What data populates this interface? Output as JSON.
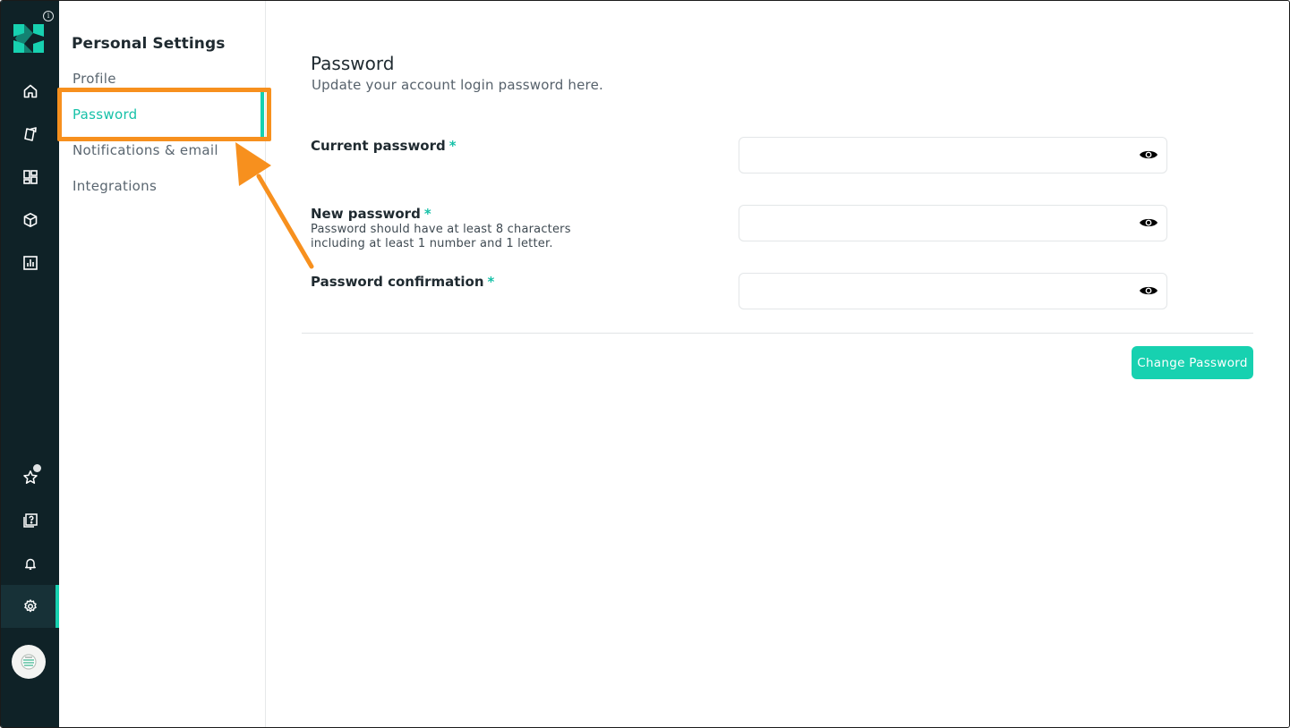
{
  "rail": {
    "items": [
      {
        "name": "home",
        "icon": "home-icon"
      },
      {
        "name": "campaigns",
        "icon": "tag-icon"
      },
      {
        "name": "dashboard",
        "icon": "dashboard-icon"
      },
      {
        "name": "products",
        "icon": "box-icon"
      },
      {
        "name": "reports",
        "icon": "bar-chart-icon"
      },
      {
        "name": "whats-new",
        "icon": "star-icon"
      },
      {
        "name": "help",
        "icon": "help-book-icon"
      },
      {
        "name": "notifications",
        "icon": "bell-icon"
      },
      {
        "name": "settings",
        "icon": "gear-icon",
        "active": true
      }
    ]
  },
  "sidebar": {
    "title": "Personal Settings",
    "items": [
      {
        "label": "Profile"
      },
      {
        "label": "Password",
        "active": true
      },
      {
        "label": "Notifications & email"
      },
      {
        "label": "Integrations"
      }
    ]
  },
  "main": {
    "title": "Password",
    "subtitle": "Update your account login password here.",
    "fields": [
      {
        "label": "Current password",
        "required_mark": "*",
        "value": "",
        "placeholder": ""
      },
      {
        "label": "New password",
        "required_mark": "*",
        "hint_line1": "Password should have at least 8 characters",
        "hint_line2": "including at least 1 number and 1 letter.",
        "value": "",
        "placeholder": ""
      },
      {
        "label": "Password confirmation",
        "required_mark": "*",
        "value": "",
        "placeholder": ""
      }
    ],
    "submit_label": "Change Password"
  },
  "colors": {
    "accent": "#17d1b0",
    "rail_bg": "#0f2227",
    "annotation": "#f7901e"
  }
}
